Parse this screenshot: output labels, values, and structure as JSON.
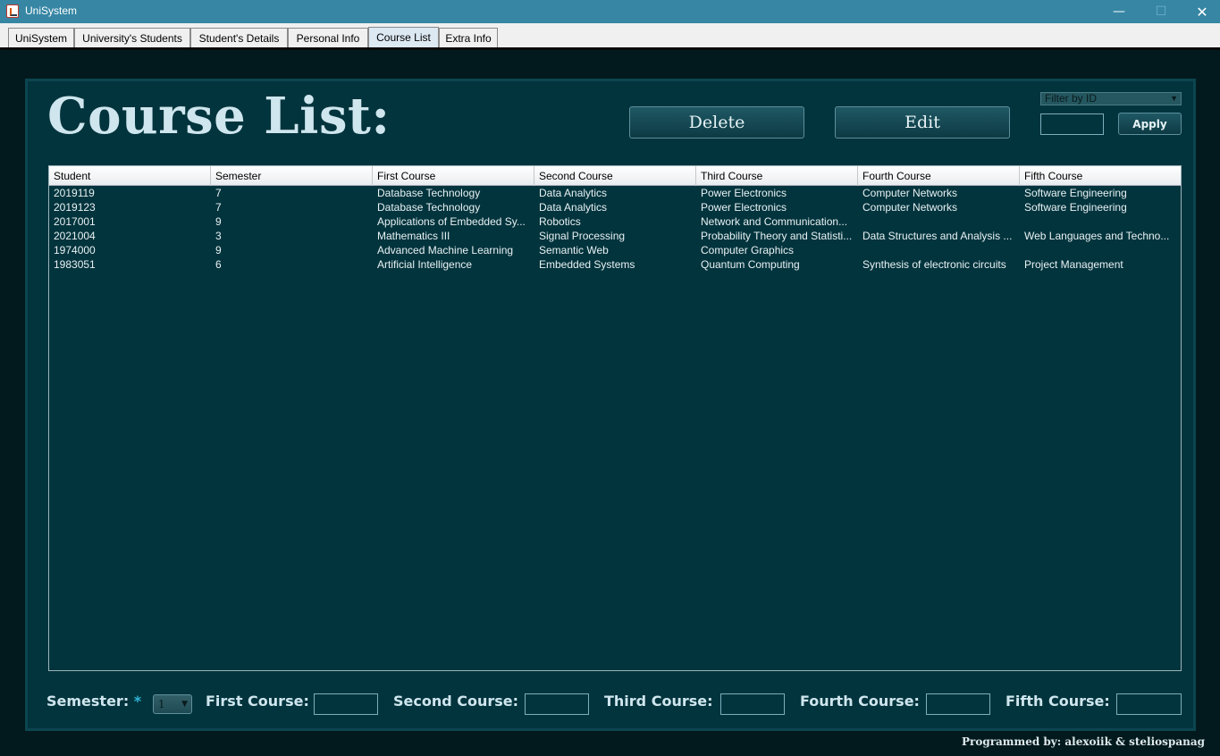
{
  "window": {
    "title": "UniSystem",
    "min_icon": "minimize-icon",
    "max_icon": "maximize-icon",
    "close_icon": "close-icon"
  },
  "tabs": [
    {
      "label": "UniSystem",
      "active": false
    },
    {
      "label": "University's Students",
      "active": false
    },
    {
      "label": "Student's Details",
      "active": false
    },
    {
      "label": "Personal Info",
      "active": false
    },
    {
      "label": "Course List",
      "active": true
    },
    {
      "label": "Extra Info",
      "active": false
    }
  ],
  "page": {
    "heading": "Course List:",
    "delete_label": "Delete",
    "edit_label": "Edit",
    "filter": {
      "selected": "Filter by ID",
      "value": ""
    },
    "apply_label": "Apply"
  },
  "table": {
    "columns": [
      "Student",
      "Semester",
      "First Course",
      "Second Course",
      "Third Course",
      "Fourth Course",
      "Fifth Course"
    ],
    "rows": [
      [
        "2019119",
        "7",
        "Database Technology",
        "Data Analytics",
        "Power Electronics",
        "Computer Networks",
        "Software Engineering"
      ],
      [
        "2019123",
        "7",
        "Database Technology",
        "Data Analytics",
        "Power Electronics",
        "Computer Networks",
        "Software Engineering"
      ],
      [
        "2017001",
        "9",
        "Applications of Embedded Sy...",
        "Robotics",
        "Network and Communication...",
        "",
        ""
      ],
      [
        "2021004",
        "3",
        "Mathematics III",
        "Signal Processing",
        "Probability Theory and Statisti...",
        "Data Structures and Analysis ...",
        "Web Languages and Techno..."
      ],
      [
        "1974000",
        "9",
        "Advanced Machine Learning",
        "Semantic Web",
        "Computer Graphics",
        "",
        ""
      ],
      [
        "1983051",
        "6",
        "Artificial Intelligence",
        "Embedded Systems",
        "Quantum Computing",
        "Synthesis of electronic circuits",
        "Project Management"
      ]
    ]
  },
  "form": {
    "semester_label": "Semester:",
    "required_mark": "*",
    "semester_value": "1",
    "first_label": "First Course:",
    "second_label": "Second Course:",
    "third_label": "Third Course:",
    "fourth_label": "Fourth Course:",
    "fifth_label": "Fifth Course:"
  },
  "credits": "Programmed by: alexoiik & steliospanag",
  "colors": {
    "background": "#021a1d",
    "panel": "#02343d",
    "titlebar": "#3686a4",
    "accent": "#2fb4d6"
  }
}
